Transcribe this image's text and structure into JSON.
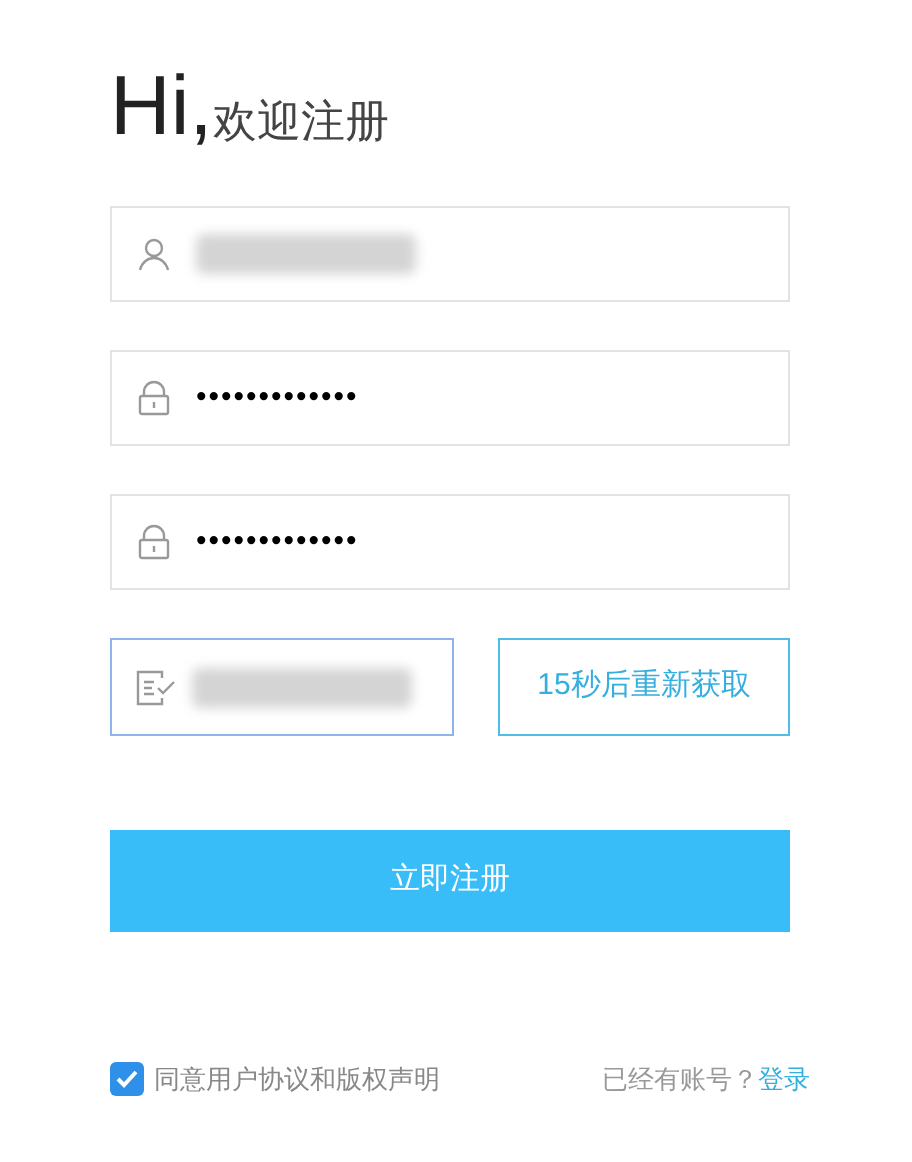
{
  "heading": {
    "greeting": "Hi,",
    "subtitle": "欢迎注册"
  },
  "fields": [
    {
      "kind": "user",
      "redacted": true,
      "focused": false
    },
    {
      "kind": "lock",
      "value": "•••••••••••••",
      "redacted": false,
      "focused": false
    },
    {
      "kind": "lock",
      "value": "•••••••••••••",
      "redacted": false,
      "focused": false
    }
  ],
  "code": {
    "kind": "code",
    "redacted": true,
    "focused": true,
    "resend_button": "15秒后重新获取"
  },
  "submit_button": "立即注册",
  "agreement": {
    "checked": true,
    "label": "同意用户协议和版权声明"
  },
  "login_prompt": {
    "text": "已经有账号？",
    "link": "登录"
  }
}
